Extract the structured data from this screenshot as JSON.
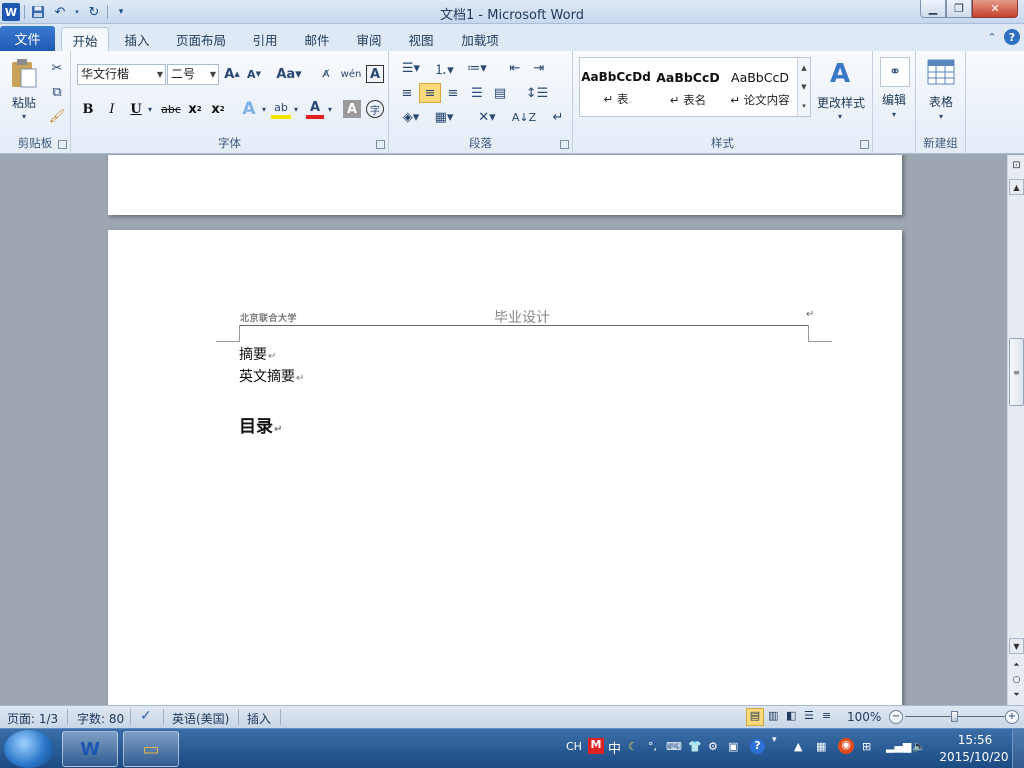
{
  "window": {
    "title": "文档1 - Microsoft Word",
    "app_icon": "W"
  },
  "ribbon_tabs": {
    "file": "文件",
    "tabs": [
      "开始",
      "插入",
      "页面布局",
      "引用",
      "邮件",
      "审阅",
      "视图",
      "加载项"
    ],
    "active": "开始"
  },
  "clipboard": {
    "paste_label": "粘贴",
    "group_label": "剪贴板"
  },
  "font": {
    "family": "华文行楷",
    "size": "二号",
    "group_label": "字体"
  },
  "paragraph": {
    "group_label": "段落"
  },
  "styles": {
    "items": [
      {
        "sample": "AaBbCcDd",
        "name": "表"
      },
      {
        "sample": "AaBbCcD",
        "name": "表名"
      },
      {
        "sample": "AaBbCcD",
        "name": "论文内容"
      }
    ],
    "change_styles_label": "更改样式",
    "group_label": "样式"
  },
  "editing": {
    "label": "编辑"
  },
  "new_group": {
    "table_label": "表格",
    "group_label": "新建组"
  },
  "document": {
    "header_logo": "北京联合大学",
    "header_center": "毕业设计",
    "lines": [
      "摘要",
      "英文摘要",
      "目录"
    ],
    "para_mark": "↵"
  },
  "status": {
    "page": "页面: 1/3",
    "words": "字数: 80",
    "language": "英语(美国)",
    "mode": "插入",
    "zoom": "100%",
    "zoom_value": 100
  },
  "taskbar": {
    "ime_lang": "CH",
    "ime_mode": "中",
    "time": "15:56",
    "date": "2015/10/20"
  }
}
